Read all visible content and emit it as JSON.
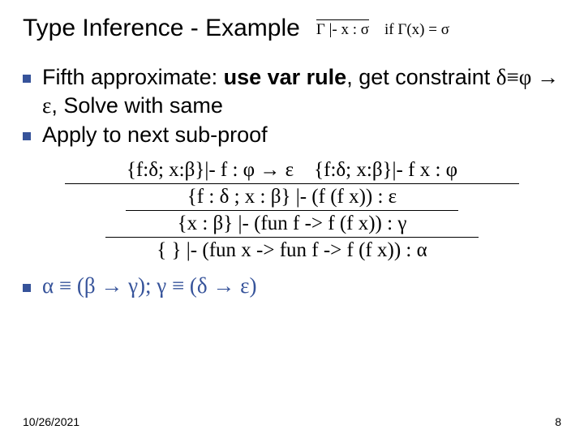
{
  "title": "Type Inference - Example",
  "title_formula_top": "",
  "title_formula_bottom": "Γ |- x : σ",
  "title_formula_side": "if Γ(x) = σ",
  "bullets": [
    "Fifth approximate: <span class='bold'>use var rule</span>, get constraint <span class='serif'>δ≡φ → ε</span>, Solve with same",
    "Apply to next sub-proof"
  ],
  "proof": {
    "line1_left": "{f:δ; x:β}|- f : φ → ε",
    "line1_right": "{f:δ; x:β}|- f x : φ",
    "line2": "{f : δ ; x : β} |- (f (f x)) : ε",
    "line3": "{x : β} |- (fun f -> f (f x)) : γ",
    "line4": "{ } |- (fun x -> fun f -> f (f x)) : α"
  },
  "conclusion": "α ≡ (β → γ);  γ ≡ (δ → ε)",
  "footer_date": "10/26/2021",
  "footer_page": "8"
}
